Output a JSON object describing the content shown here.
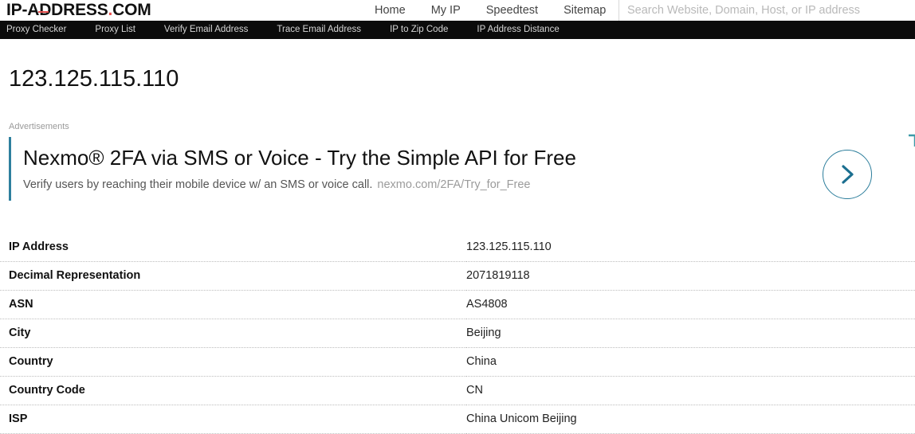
{
  "header": {
    "logo": {
      "prefix": "IP-A",
      "strike_letter": "D",
      "middle": "DRESS",
      "dot": ".",
      "suffix": "COM"
    },
    "nav": [
      {
        "label": "Home"
      },
      {
        "label": "My IP"
      },
      {
        "label": "Speedtest"
      },
      {
        "label": "Sitemap"
      }
    ],
    "search": {
      "placeholder": "Search Website, Domain, Host, or IP address",
      "value": ""
    }
  },
  "subnav": {
    "items": [
      {
        "label": "Proxy Checker"
      },
      {
        "label": "Proxy List"
      },
      {
        "label": "Verify Email Address"
      },
      {
        "label": "Trace Email Address"
      },
      {
        "label": "IP to Zip Code"
      },
      {
        "label": "IP Address Distance"
      }
    ]
  },
  "main": {
    "page_title": "123.125.115.110",
    "ads_label": "Advertisements",
    "ad": {
      "title": "Nexmo® 2FA via SMS or Voice - Try the Simple API for Free",
      "description": "Verify users by reaching their mobile device w/ an SMS or voice call.",
      "url": "nexmo.com/2FA/Try_for_Free",
      "arrow_icon": "chevron-right-icon",
      "accent_color": "#2b7d9b"
    },
    "info_rows": [
      {
        "key": "IP Address",
        "value": "123.125.115.110"
      },
      {
        "key": "Decimal Representation",
        "value": "2071819118"
      },
      {
        "key": "ASN",
        "value": "AS4808"
      },
      {
        "key": "City",
        "value": "Beijing"
      },
      {
        "key": "Country",
        "value": "China"
      },
      {
        "key": "Country Code",
        "value": "CN"
      },
      {
        "key": "ISP",
        "value": "China Unicom Beijing"
      }
    ]
  },
  "colors": {
    "logo_accent": "#e8504f",
    "subnav_bg": "#0b0b0b",
    "ad_accent": "#2b7d9b"
  }
}
